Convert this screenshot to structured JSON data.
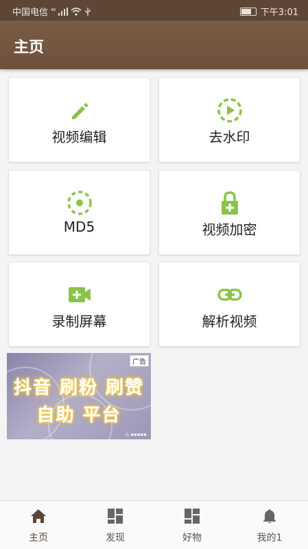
{
  "status_bar": {
    "carrier": "中国电信",
    "signal": "⁴⁶",
    "time": "下午3:01"
  },
  "header": {
    "title": "主页"
  },
  "colors": {
    "accent_green": "#8bc34a",
    "header_brown": "#6e513d",
    "nav_active": "#5e4636",
    "nav_inactive": "#666666"
  },
  "cards": [
    {
      "label": "视频编辑",
      "icon": "pencil-icon"
    },
    {
      "label": "去水印",
      "icon": "play-circle-icon"
    },
    {
      "label": "MD5",
      "icon": "target-dashed-icon"
    },
    {
      "label": "视频加密",
      "icon": "lock-plus-icon"
    },
    {
      "label": "录制屏幕",
      "icon": "video-plus-icon"
    },
    {
      "label": "解析视频",
      "icon": "link-icon"
    }
  ],
  "ad": {
    "line1": "抖音 刷粉 刷赞",
    "line2": "自助 平台",
    "badge": "广告"
  },
  "bottom_nav": {
    "items": [
      {
        "label": "主页",
        "icon": "home-icon",
        "active": true
      },
      {
        "label": "发现",
        "icon": "grid-icon"
      },
      {
        "label": "好物",
        "icon": "grid-icon"
      },
      {
        "label": "我的1",
        "icon": "bell-icon"
      }
    ]
  }
}
